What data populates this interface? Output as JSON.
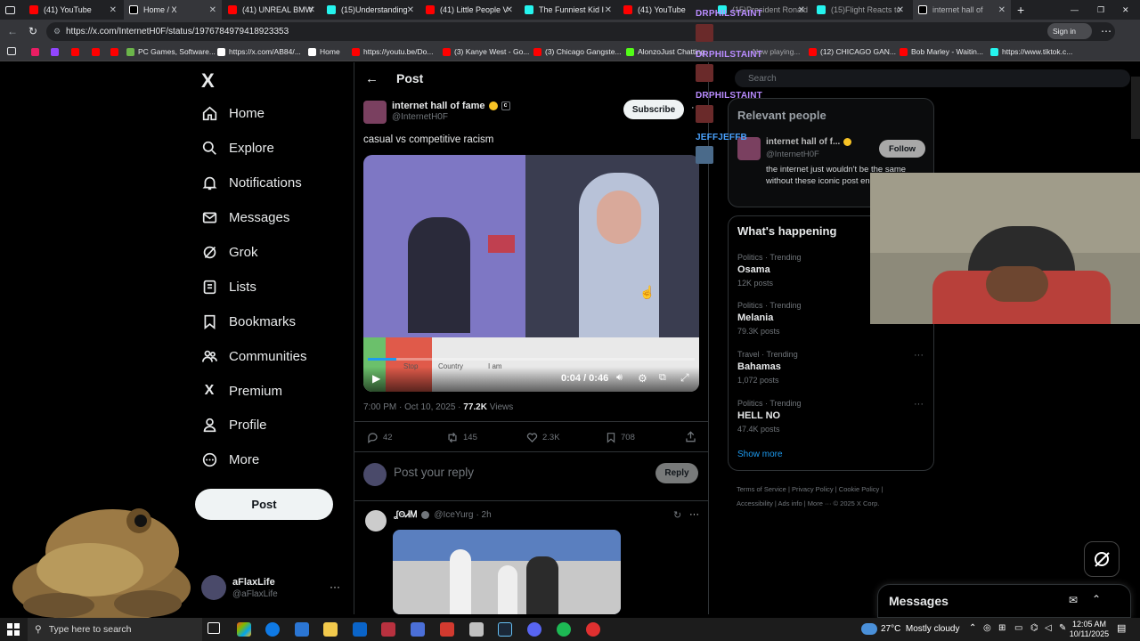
{
  "browser": {
    "tabs": [
      {
        "label": "(41) YouTube",
        "color": "#ff0000"
      },
      {
        "label": "Home / X",
        "color": "#ffffff"
      },
      {
        "label": "(41) UNREAL BMW",
        "color": "#ff0000"
      },
      {
        "label": "(15)Understanding",
        "color": "#25f4ee"
      },
      {
        "label": "(41) Little People V",
        "color": "#ff0000"
      },
      {
        "label": "The Funniest Kid I",
        "color": "#25f4ee"
      },
      {
        "label": "(41) YouTube",
        "color": "#ff0000"
      },
      {
        "label": "(15)President Ronald",
        "color": "#25f4ee"
      },
      {
        "label": "(15)Flight Reacts to",
        "color": "#25f4ee"
      },
      {
        "label": "internet hall of",
        "color": "#ffffff"
      }
    ],
    "url": "https://x.com/InternetH0F/status/1976784979418923353",
    "sign_in": "Sign in",
    "bookmarks": [
      "PC Games, Software...",
      "https://x.com/AB84/...",
      "Home",
      "https://youtu.be/Do...",
      "(3) Kanye West - Go...",
      "(3) Chicago Gangste...",
      "AlonzoJust Chatting",
      "Now playing...",
      "(12) CHICAGO GAN...",
      "Bob Marley - Waitin...",
      "https://www.tiktok.c..."
    ]
  },
  "nav": {
    "logo": "X",
    "items": [
      "Home",
      "Explore",
      "Notifications",
      "Messages",
      "Grok",
      "Lists",
      "Bookmarks",
      "Communities",
      "Premium",
      "Profile",
      "More"
    ],
    "post_button": "Post",
    "account_name": "aFlaxLife",
    "account_handle": "@aFlaxLife"
  },
  "post": {
    "header_title": "Post",
    "author_name": "internet hall of fame",
    "author_handle": "@InternetH0F",
    "subscribe_label": "Subscribe",
    "text": "casual vs competitive racism",
    "video_time": "0:04 / 0:46",
    "video_caption_1": "Stop",
    "video_caption_2": "Country",
    "video_caption_3": "I am",
    "progress": 0.087,
    "timestamp": "7:00 PM · Oct 10, 2025 · ",
    "views_count": "77.2K",
    "views_label": " Views",
    "replies": "42",
    "reposts": "145",
    "likes": "2.3K",
    "bookmarks": "708",
    "reply_placeholder": "Post your reply",
    "reply_button": "Reply"
  },
  "reply_tweet": {
    "name": "ʆʘᏗᎷ",
    "handle": "@IceYurg",
    "time": "· 2h"
  },
  "right": {
    "search_placeholder": "Search",
    "relevant_title": "Relevant people",
    "relevant_name": "internet hall of f...",
    "relevant_handle": "@InternetH0F",
    "follow_label": "Follow",
    "relevant_bio": "the internet just wouldn't be the same without these iconic post endorsement",
    "happening_title": "What's happening",
    "trends": [
      {
        "meta": "Politics · Trending",
        "name": "Osama",
        "count": "12K posts"
      },
      {
        "meta": "Politics · Trending",
        "name": "Melania",
        "count": "79.3K posts"
      },
      {
        "meta": "Travel · Trending",
        "name": "Bahamas",
        "count": "1,072 posts"
      },
      {
        "meta": "Politics · Trending",
        "name": "HELL NO",
        "count": "47.4K posts"
      }
    ],
    "show_more": "Show more",
    "footer_1": "Terms of Service",
    "footer_2": "Privacy Policy",
    "footer_3": "Cookie Policy",
    "footer_4": "Accessibility",
    "footer_5": "Ads info",
    "footer_6": "More ···",
    "footer_7": "© 2025 X Corp.",
    "messages_title": "Messages"
  },
  "chat": {
    "names": [
      "DRPHILSTAINT",
      "DRPHILSTAINT",
      "DRPHILSTAINT",
      "JEFFJEFFB"
    ]
  },
  "taskbar": {
    "search_placeholder": "Type here to search",
    "weather": "27°C  Mostly cloudy",
    "time": "12:05 AM",
    "date": "10/11/2025"
  },
  "colors": {
    "accent": "#1d9bf0",
    "verified": "#f7c325",
    "chat_name": "#b98cff"
  }
}
